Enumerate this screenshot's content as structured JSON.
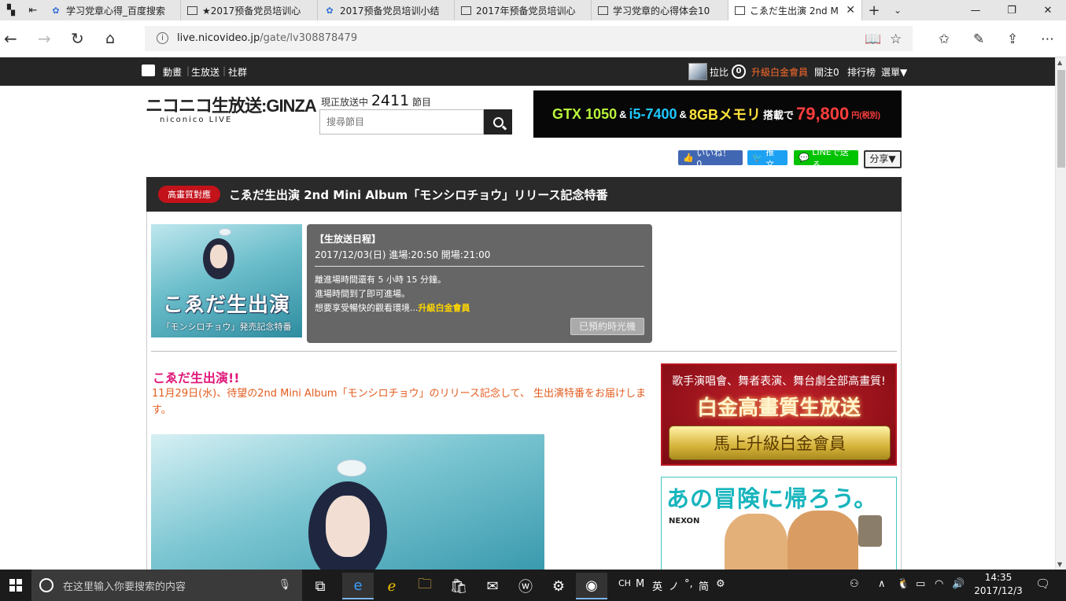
{
  "browser": {
    "tabs": [
      {
        "title": "学习党章心得_百度搜索",
        "icon": "baidu-paw-icon"
      },
      {
        "title": "★2017预备党员培训心",
        "icon": "document-icon"
      },
      {
        "title": "2017预备党员培训小结",
        "icon": "baidu-paw-icon"
      },
      {
        "title": "2017年预备党员培训心",
        "icon": "document-icon"
      },
      {
        "title": "学习党章的心得体会10",
        "icon": "document-icon"
      },
      {
        "title": "こゑだ生出演 2nd M",
        "icon": "document-icon",
        "active": true
      }
    ],
    "url_domain": "live.nicovideo.jp",
    "url_path": "/gate/lv308878479"
  },
  "nicobar": {
    "links": [
      "動畫",
      "生放送",
      "社群"
    ],
    "user_name": "拉比",
    "coins": "0",
    "premium_label": "升級白金會員",
    "follow_label": "關注0",
    "ranking_label": "排行榜",
    "menu_label": "選單▼"
  },
  "header": {
    "logo_main": "ニコニコ生放送:GINZA",
    "logo_sub": "niconico LIVE",
    "onair_prefix": "現正放送中",
    "onair_count": "2411",
    "onair_suffix": "節目",
    "search_placeholder": "搜尋節目"
  },
  "ad_gtx": {
    "part1": "GTX 1050",
    "amp1": "&",
    "part2": "i5-7400",
    "amp2": "&",
    "part3": "8GBメモリ",
    "mid": "搭載で",
    "price": "79,800",
    "yen": "円(税別)"
  },
  "share": {
    "facebook": "いいね！ 0",
    "twitter": "推文",
    "line": "LINEで送る",
    "share": "分享▼"
  },
  "program": {
    "quality_badge": "高畫質對應",
    "title": "こゑだ生出演 2nd Mini Album「モンシロチョウ」リリース記念特番",
    "thumb_title": "こゑだ生出演",
    "thumb_sub": "「モンシロチョウ」発売記念特番",
    "schedule_heading": "【生放送日程】",
    "schedule_date": "2017/12/03(日) 進場:20:50 開場:21:00",
    "notice_1": "離進場時間還有 5 小時 15 分鐘。",
    "notice_2": "進場時間到了即可進場。",
    "notice_3": "想要享受暢快的觀看環境...",
    "notice_upgrade": "升級白金會員",
    "reserved_button": "已預約時光機",
    "desc_heading": "こゑだ生出演!!",
    "desc_body": "11月29日(水)、待望の2nd Mini Album「モンシロチョウ」のリリース記念して、 生出演特番をお届けします。"
  },
  "ads": {
    "premium_top": "歌手演唱會、舞者表演、舞台劇全部高畫質!",
    "premium_mid": "白金高畫質生放送",
    "premium_btn": "馬上升級白金會員",
    "game_title": "あの冒険に帰ろう。",
    "game_brand": "NEXON"
  },
  "taskbar": {
    "search_placeholder": "在这里输入你要搜索的内容",
    "ime": [
      "CH",
      "M",
      "英",
      "ノ",
      "°,",
      "简",
      "⚙"
    ],
    "time": "14:35",
    "date": "2017/12/3"
  }
}
